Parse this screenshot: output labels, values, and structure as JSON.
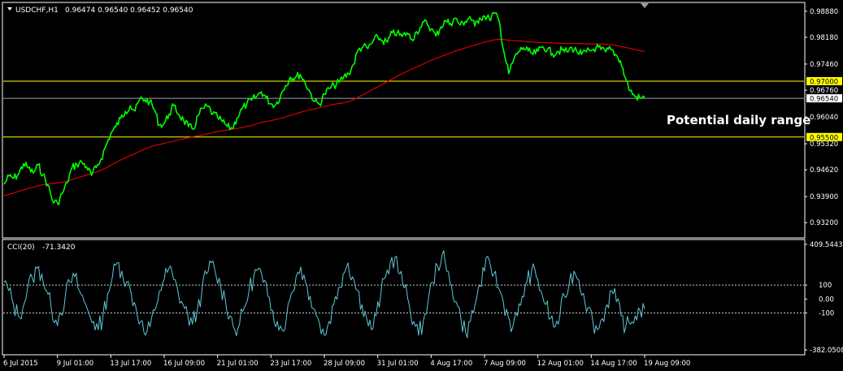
{
  "price_header": {
    "symbol_tf": "USDCHF,H1",
    "ohlc": "0.96474 0.96540 0.96452 0.96540"
  },
  "annotation": "Potential daily range",
  "indicator_header": {
    "name": "CCI(20)",
    "value": "-71.3420"
  },
  "colors": {
    "background": "#000000",
    "price_line": "#00ff00",
    "moving_average": "#ff0000",
    "support_resistance": "#ffff00",
    "current_price_line": "#9aa0b3",
    "cci_line": "#5ec8d8",
    "grid_text": "#ffffff"
  },
  "chart_data": [
    {
      "type": "line",
      "title": "",
      "price_axis_ticks": [
        "0.98880",
        "0.98180",
        "0.97460",
        "0.96760",
        "0.96040",
        "0.95320",
        "0.94620",
        "0.93900",
        "0.93200"
      ],
      "ylim": [
        0.929,
        0.9905
      ],
      "level_labels": [
        {
          "value": 0.97,
          "text": "0.97000",
          "style": "yellow-box"
        },
        {
          "value": 0.9654,
          "text": "0.96540",
          "style": "white-box"
        },
        {
          "value": 0.955,
          "text": "0.95500",
          "style": "yellow-box"
        }
      ],
      "horizontal_lines": [
        0.97,
        0.9654,
        0.955
      ],
      "series": [
        {
          "values": [
            0.9423,
            0.9445,
            0.9439,
            0.9451,
            0.9478,
            0.9467,
            0.9453,
            0.9475,
            0.9449,
            0.9422,
            0.9378,
            0.9372,
            0.9398,
            0.9427,
            0.9468,
            0.9476,
            0.9483,
            0.947,
            0.9447,
            0.9468,
            0.9491,
            0.9527,
            0.9559,
            0.9577,
            0.96,
            0.9619,
            0.9634,
            0.962,
            0.9652,
            0.965,
            0.9645,
            0.9623,
            0.9582,
            0.9586,
            0.9612,
            0.9634,
            0.9611,
            0.9595,
            0.9578,
            0.9571,
            0.9608,
            0.9627,
            0.9632,
            0.9612,
            0.9603,
            0.9591,
            0.9578,
            0.9573,
            0.9601,
            0.9625,
            0.9638,
            0.9649,
            0.9658,
            0.9672,
            0.9656,
            0.9639,
            0.9637,
            0.9662,
            0.9688,
            0.9711,
            0.971,
            0.9718,
            0.9697,
            0.9672,
            0.9645,
            0.9638,
            0.9665,
            0.968,
            0.9688,
            0.9697,
            0.9712,
            0.972,
            0.9745,
            0.9785,
            0.9793,
            0.9788,
            0.9806,
            0.9819,
            0.9808,
            0.9805,
            0.983,
            0.9829,
            0.982,
            0.983,
            0.9812,
            0.9833,
            0.9846,
            0.9861,
            0.984,
            0.9821,
            0.9846,
            0.9862,
            0.9855,
            0.9869,
            0.9851,
            0.986,
            0.9873,
            0.9848,
            0.987,
            0.9875,
            0.9867,
            0.9883,
            0.9862,
            0.9779,
            0.972,
            0.9757,
            0.9779,
            0.979,
            0.9781,
            0.9772,
            0.978,
            0.9793,
            0.9786,
            0.9774,
            0.978,
            0.9783,
            0.9779,
            0.979,
            0.9781,
            0.9772,
            0.9779,
            0.9782,
            0.9791,
            0.9785,
            0.9779,
            0.9786,
            0.9772,
            0.9755,
            0.971,
            0.9674,
            0.9659,
            0.9655,
            0.9654
          ]
        },
        {
          "values": [
            0.9392,
            0.9396,
            0.94,
            0.9404,
            0.9408,
            0.9412,
            0.9415,
            0.9419,
            0.9422,
            0.9424,
            0.9425,
            0.9427,
            0.9429,
            0.9432,
            0.9436,
            0.944,
            0.9444,
            0.9448,
            0.9452,
            0.9456,
            0.9461,
            0.9467,
            0.9474,
            0.9481,
            0.9488,
            0.9494,
            0.95,
            0.9506,
            0.9512,
            0.9518,
            0.9523,
            0.9527,
            0.953,
            0.9533,
            0.9536,
            0.9539,
            0.9542,
            0.9545,
            0.9548,
            0.9551,
            0.9553,
            0.9556,
            0.9559,
            0.9562,
            0.9565,
            0.9567,
            0.9569,
            0.9571,
            0.9573,
            0.9575,
            0.9578,
            0.9581,
            0.9585,
            0.9589,
            0.9592,
            0.9594,
            0.9597,
            0.96,
            0.9604,
            0.9608,
            0.9612,
            0.9616,
            0.962,
            0.9623,
            0.9626,
            0.9629,
            0.9632,
            0.9635,
            0.9638,
            0.964,
            0.9642,
            0.9645,
            0.965,
            0.9657,
            0.9664,
            0.9671,
            0.9678,
            0.9685,
            0.9692,
            0.9699,
            0.9706,
            0.9713,
            0.972,
            0.9726,
            0.9732,
            0.9738,
            0.9744,
            0.975,
            0.9756,
            0.9761,
            0.9766,
            0.9771,
            0.9776,
            0.9781,
            0.9785,
            0.9789,
            0.9793,
            0.9797,
            0.9801,
            0.9805,
            0.9808,
            0.9811,
            0.9813,
            0.9812,
            0.981,
            0.9809,
            0.9808,
            0.9807,
            0.9806,
            0.9805,
            0.9804,
            0.9804,
            0.9803,
            0.9803,
            0.9802,
            0.9802,
            0.9801,
            0.9801,
            0.9801,
            0.9801,
            0.98,
            0.98,
            0.98,
            0.98,
            0.9799,
            0.9798,
            0.9796,
            0.9794,
            0.9791,
            0.9788,
            0.9785,
            0.9782,
            0.978
          ]
        }
      ]
    },
    {
      "type": "line",
      "title": "",
      "cci_axis_ticks": [
        "409.5443",
        "100",
        "0.00",
        "-100",
        "-382.0508"
      ],
      "ylim": [
        -382.0508,
        409.5443
      ],
      "dotted_levels": [
        100,
        -100
      ],
      "x_tick_labels": [
        "6 Jul 2015",
        "9 Jul 01:00",
        "13 Jul 17:00",
        "16 Jul 09:00",
        "21 Jul 01:00",
        "23 Jul 17:00",
        "28 Jul 09:00",
        "31 Jul 01:00",
        "4 Aug 17:00",
        "7 Aug 09:00",
        "12 Aug 01:00",
        "14 Aug 17:00",
        "19 Aug 09:00"
      ],
      "series": [
        {
          "values": [
            120,
            60,
            -40,
            -120,
            -60,
            80,
            150,
            220,
            180,
            60,
            -60,
            -150,
            -100,
            20,
            120,
            160,
            60,
            -20,
            -100,
            -160,
            -220,
            -120,
            40,
            160,
            260,
            200,
            120,
            40,
            -60,
            -160,
            -260,
            -200,
            -80,
            60,
            140,
            220,
            140,
            40,
            -40,
            -120,
            -180,
            -80,
            60,
            180,
            260,
            170,
            90,
            -10,
            -120,
            -220,
            -180,
            -60,
            60,
            160,
            220,
            120,
            20,
            -80,
            -160,
            -220,
            -120,
            40,
            160,
            230,
            120,
            20,
            -80,
            -180,
            -260,
            -160,
            -40,
            80,
            180,
            260,
            160,
            60,
            -40,
            -140,
            -220,
            -120,
            40,
            160,
            260,
            300,
            180,
            80,
            -40,
            -160,
            -260,
            -160,
            -20,
            120,
            240,
            320,
            200,
            100,
            -20,
            -140,
            -240,
            -160,
            -40,
            100,
            200,
            280,
            180,
            80,
            -20,
            -120,
            -200,
            -120,
            20,
            120,
            200,
            160,
            60,
            -40,
            -140,
            -200,
            -120,
            20,
            120,
            200,
            140,
            40,
            -60,
            -160,
            -220,
            -140,
            -40,
            60,
            -20,
            -120,
            -200,
            -180,
            -120,
            -80,
            -71
          ]
        }
      ]
    }
  ]
}
